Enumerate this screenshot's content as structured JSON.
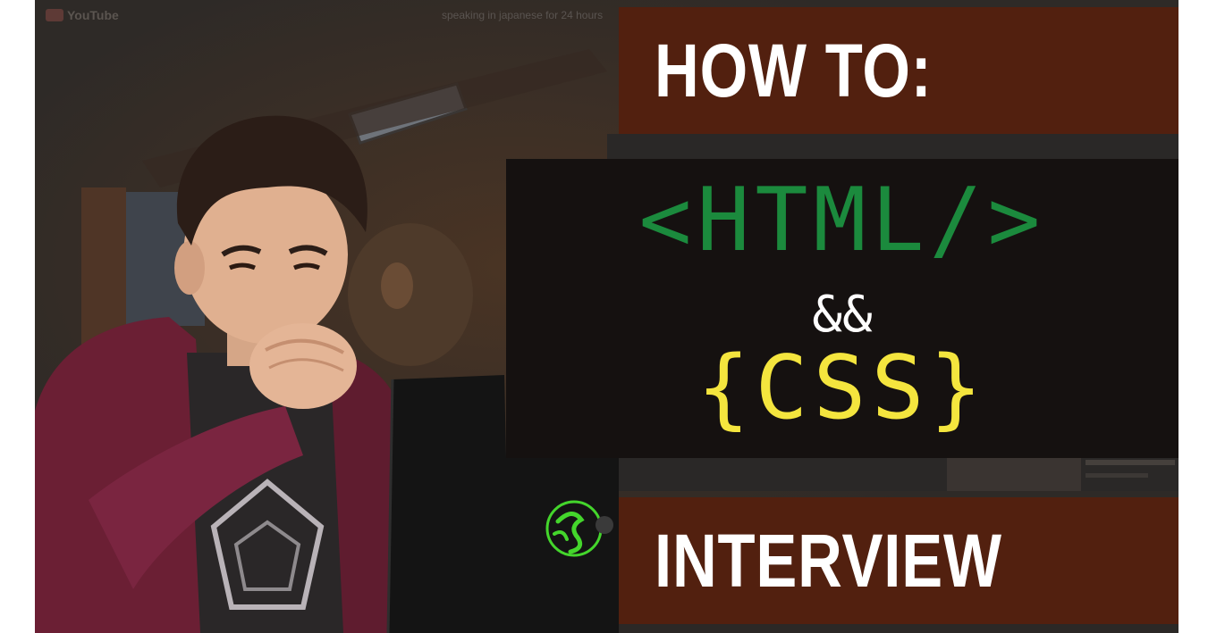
{
  "video_player": {
    "logo_text": "YouTube",
    "video_title": "speaking in japanese for 24 hours"
  },
  "thumbnail": {
    "top_banner": "HOW TO:",
    "html_tag": "<HTML/>",
    "operator": "&&",
    "css_braces": "{CSS}",
    "bottom_banner": "INTERVIEW"
  },
  "colors": {
    "banner_brown": "#52200f",
    "code_box": "#151110",
    "html_green": "#1b8a3d",
    "css_yellow": "#f4e53e",
    "razer_green": "#44d62c"
  }
}
